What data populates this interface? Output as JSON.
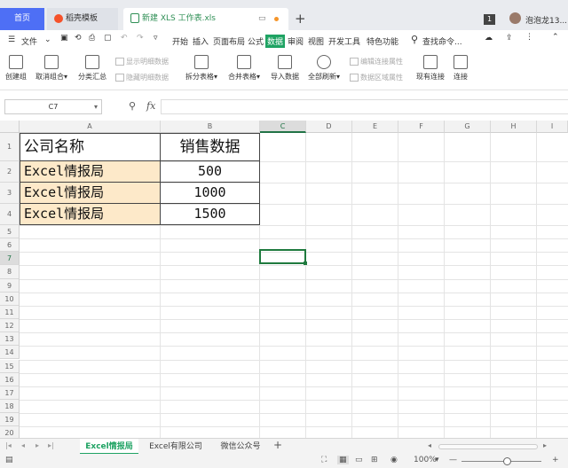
{
  "titlebar": {
    "home_tab": "首页",
    "template_tab": "稻壳模板",
    "doc_tab": "新建 XLS 工作表.xls",
    "notification_count": "1",
    "username": "泡泡龙13..."
  },
  "menubar": {
    "file": "文件",
    "items": [
      "开始",
      "插入",
      "页面布局",
      "公式",
      "数据",
      "审阅",
      "视图",
      "开发工具",
      "特色功能"
    ],
    "active_item": "数据",
    "search": "查找命令..."
  },
  "ribbon": {
    "create_group": "创建组",
    "ungroup": "取消组合",
    "subtotal": "分类汇总",
    "show_detail": "显示明细数据",
    "hide_detail": "隐藏明细数据",
    "split_table": "拆分表格",
    "merge_table": "合并表格",
    "import_data": "导入数据",
    "refresh_all": "全部刷新",
    "edit_link": "编辑连接属性",
    "data_range": "数据区域属性",
    "existing_conn": "现有连接",
    "connect": "连接"
  },
  "formula_bar": {
    "name_box": "C7",
    "fx": "fx",
    "value": ""
  },
  "columns": [
    "A",
    "B",
    "C",
    "D",
    "E",
    "F",
    "G",
    "H",
    "I"
  ],
  "selected_column": "C",
  "rows": [
    "1",
    "2",
    "3",
    "4",
    "5",
    "6",
    "7",
    "8",
    "9",
    "10",
    "11",
    "12",
    "13",
    "14",
    "15",
    "16",
    "17",
    "18",
    "19",
    "20"
  ],
  "selected_row": "7",
  "table": {
    "header": [
      "公司名称",
      "销售数据"
    ],
    "body": [
      [
        "Excel情报局",
        "500"
      ],
      [
        "Excel情报局",
        "1000"
      ],
      [
        "Excel情报局",
        "1500"
      ]
    ]
  },
  "sheets": [
    "Excel情报局",
    "Excel有限公司",
    "微信公众号"
  ],
  "active_sheet": "Excel情报局",
  "status": {
    "zoom": "100%"
  },
  "colors": {
    "accent_green": "#1fa363",
    "home_tab_blue": "#4e6ff5",
    "highlight_fill": "#fde9c9"
  }
}
